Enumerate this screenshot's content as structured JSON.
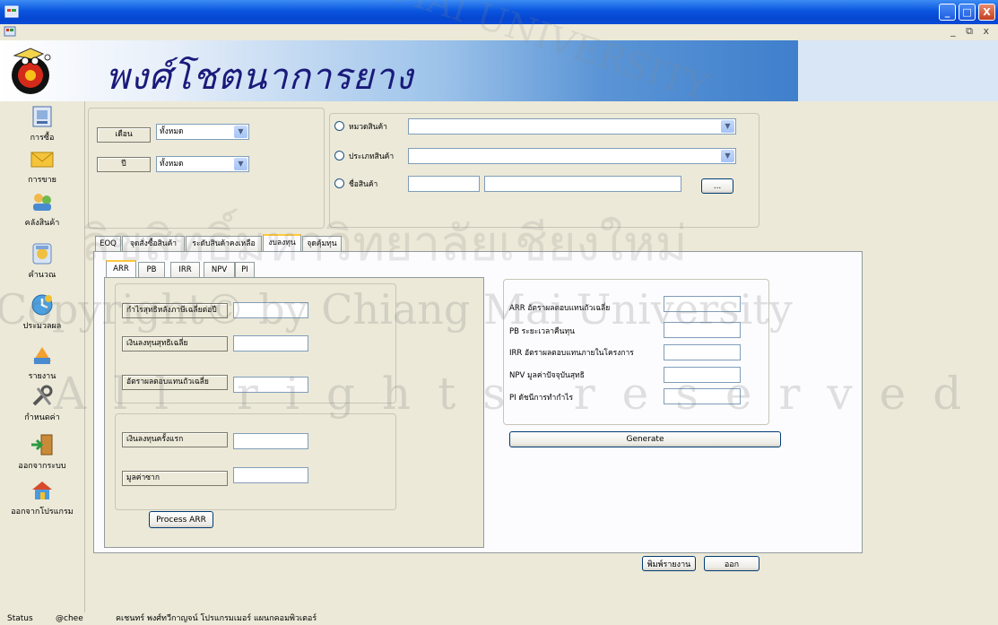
{
  "window": {
    "minimize": "_",
    "maximize": "□",
    "close": "X",
    "mdi_controls": "_ ⧉ x"
  },
  "banner": {
    "brand": "พงศ์โชตนาการยาง"
  },
  "sidebar": {
    "items": [
      {
        "label": "การซื้อ",
        "icon": "purchase-icon"
      },
      {
        "label": "การขาย",
        "icon": "sales-envelope-icon"
      },
      {
        "label": "คลังสินค้า",
        "icon": "warehouse-icon"
      },
      {
        "label": "คำนวณ",
        "icon": "calculate-icon"
      },
      {
        "label": "ประมวลผล",
        "icon": "process-icon"
      },
      {
        "label": "รายงาน",
        "icon": "report-icon"
      },
      {
        "label": "กำหนดค่า",
        "icon": "settings-tools-icon"
      },
      {
        "label": "ออกจากระบบ",
        "icon": "logout-door-icon"
      },
      {
        "label": "ออกจากโปรแกรม",
        "icon": "exit-program-icon"
      }
    ]
  },
  "filters": {
    "month_label": "เดือน",
    "month_value": "ทั้งหมด",
    "year_label": "ปี",
    "year_value": "ทั้งหมด",
    "category_label": "หมวดสินค้า",
    "category_value": "",
    "type_label": "ประเภทสินค้า",
    "type_value": "",
    "product_label": "ชื่อสินค้า",
    "product_code": "",
    "product_name": "",
    "browse_label": "..."
  },
  "main_tabs": [
    "EOQ",
    "จุดสั่งซื้อสินค้า",
    "ระดับสินค้าคงเหลือ",
    "งบลงทุน",
    "จุดคุ้มทุน"
  ],
  "main_tab_active": 3,
  "sub_tabs": [
    "ARR",
    "PB",
    "IRR",
    "NPV",
    "PI"
  ],
  "sub_tab_active": 0,
  "arr_form": {
    "profit_label": "กำไรสุทธิหลังภาษีเฉลี่ยต่อปี",
    "avg_invest_label": "เงินลงทุนสุทธิเฉลี่ย",
    "avg_return_label": "อัตราผลตอบแทนถัวเฉลี่ย",
    "initial_invest_label": "เงินลงทุนครั้งแรก",
    "salvage_label": "มูลค่าซาก",
    "process_button": "Process ARR"
  },
  "results": {
    "arr_label": "ARR อัตราผลตอบแทนถัวเฉลี่ย",
    "pb_label": "PB ระยะเวลาคืนทุน",
    "irr_label": "IRR อัตราผลตอบแทนภายในโครงการ",
    "npv_label": "NPV มูลค่าปัจจุบันสุทธิ",
    "pi_label": "PI ดัชนีการทำกำไร",
    "generate_button": "Generate"
  },
  "footer_buttons": {
    "print": "พิมพ์รายงาน",
    "exit": "ออก"
  },
  "statusbar": {
    "status": "Status",
    "user": "@chee",
    "credit": "คเชนทร์ พงศ์ทวีกาญจน์ โปรแกรมเมอร์ แผนกคอมพิวเตอร์"
  },
  "watermark": {
    "line1": "ลิขสิทธิ์มหาวิทยาลัยเชียงใหม่",
    "line2": "Copyright© by Chiang Mai University",
    "line3": "All rights reserved",
    "seal": "MAI UNIVERSITY"
  },
  "colors": {
    "titlebar": "#0a55df",
    "accent_tab": "#ffc83c",
    "brand_text": "#1a1a7a"
  }
}
